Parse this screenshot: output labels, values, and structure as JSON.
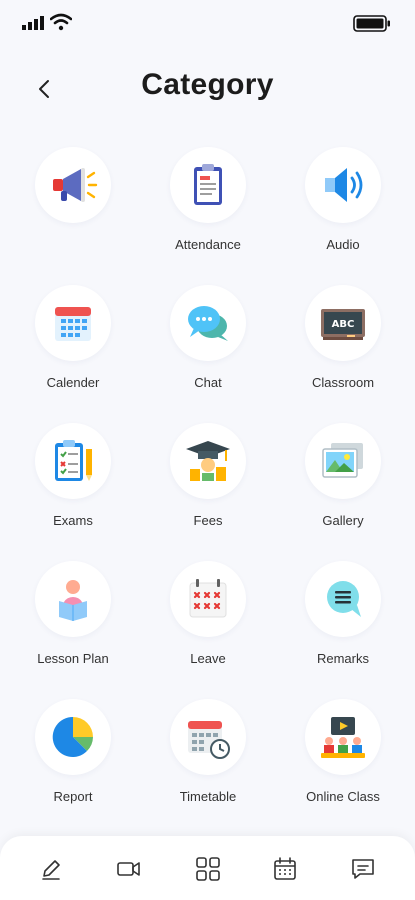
{
  "header": {
    "title": "Category"
  },
  "categories": [
    {
      "label": "",
      "icon": "megaphone-icon"
    },
    {
      "label": "Attendance",
      "icon": "clipboard-icon"
    },
    {
      "label": "Audio",
      "icon": "speaker-icon"
    },
    {
      "label": "Calender",
      "icon": "calendar-icon"
    },
    {
      "label": "Chat",
      "icon": "chat-icon"
    },
    {
      "label": "Classroom",
      "icon": "blackboard-icon"
    },
    {
      "label": "Exams",
      "icon": "exam-checklist-icon"
    },
    {
      "label": "Fees",
      "icon": "graduation-fees-icon"
    },
    {
      "label": "Gallery",
      "icon": "gallery-icon"
    },
    {
      "label": "Lesson Plan",
      "icon": "reading-student-icon"
    },
    {
      "label": "Leave",
      "icon": "leave-calendar-icon"
    },
    {
      "label": "Remarks",
      "icon": "remarks-bubble-icon"
    },
    {
      "label": "Report",
      "icon": "pie-chart-icon"
    },
    {
      "label": "Timetable",
      "icon": "timetable-icon"
    },
    {
      "label": "Online Class",
      "icon": "online-class-icon"
    }
  ],
  "bottom_nav": [
    "edit-icon",
    "video-icon",
    "grid-icon",
    "calendar-icon",
    "message-icon"
  ],
  "colors": {
    "background": "#f7f8fc",
    "accent": "#1e88e5"
  }
}
